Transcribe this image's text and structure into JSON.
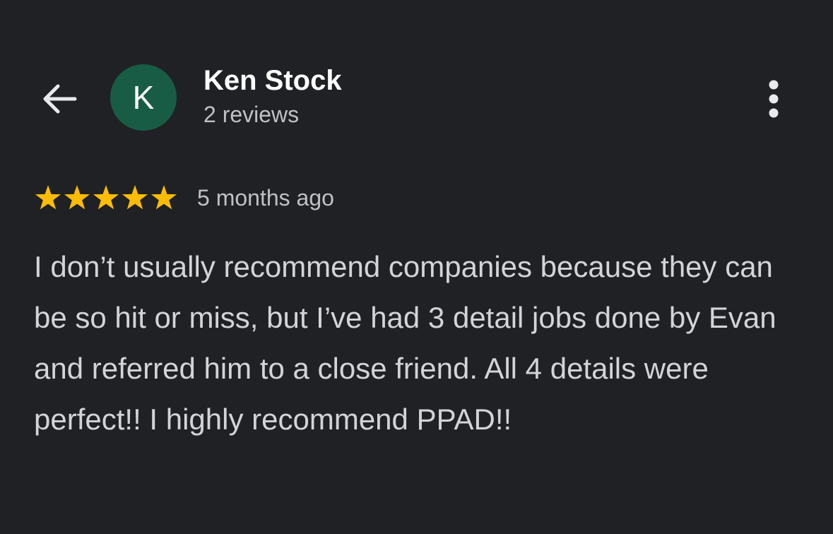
{
  "header": {
    "back_icon": "arrow-left-icon",
    "more_icon": "more-vert-icon"
  },
  "reviewer": {
    "initial": "K",
    "name": "Ken Stock",
    "review_count": "2 reviews",
    "avatar_color": "#185c45"
  },
  "review": {
    "rating": 5,
    "rating_max": 5,
    "star_color": "#fbbc04",
    "time": "5 months ago",
    "text": "I don’t usually recommend companies because they can be so hit or miss, but I’ve had 3 detail jobs done by Evan and referred him to a close friend. All 4 details were perfect!! I highly recommend PPAD!!"
  }
}
